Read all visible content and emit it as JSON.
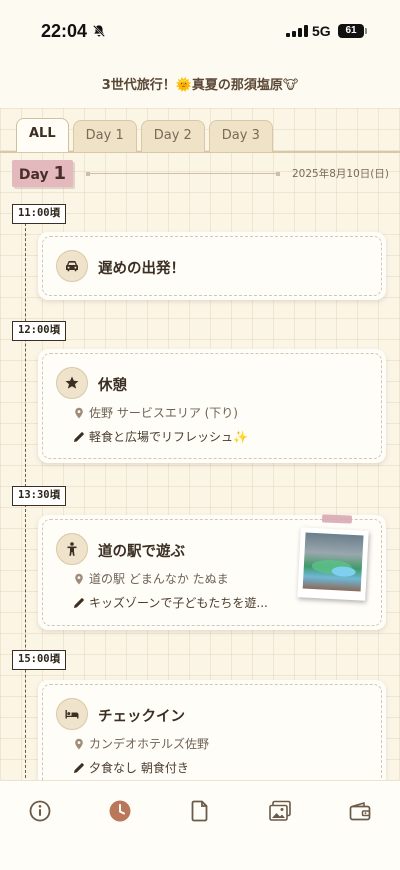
{
  "status_bar": {
    "time": "22:04",
    "network": "5G",
    "battery": "61"
  },
  "header": {
    "title": "3世代旅行！🌞真夏の那須塩原🐮"
  },
  "tabs": [
    {
      "label": "ALL",
      "active": true
    },
    {
      "label": "Day 1",
      "active": false
    },
    {
      "label": "Day 2",
      "active": false
    },
    {
      "label": "Day 3",
      "active": false
    }
  ],
  "day": {
    "prefix": "Day",
    "number": "1",
    "date": "2025年8月10日(日)"
  },
  "events": [
    {
      "time": "11:00頃",
      "icon": "car-icon",
      "title": "遅めの出発！"
    },
    {
      "time": "12:00頃",
      "icon": "star-icon",
      "title": "休憩",
      "location": "佐野 サービスエリア (下り)",
      "note": "軽食と広場でリフレッシュ✨"
    },
    {
      "time": "13:30頃",
      "icon": "child-icon",
      "title": "道の駅で遊ぶ",
      "location": "道の駅 どまんなか たぬま",
      "note": "キッズゾーンで子どもたちを遊...",
      "has_photo": true
    },
    {
      "time": "15:00頃",
      "icon": "bed-icon",
      "title": "チェックイン",
      "location": "カンデオホテルズ佐野",
      "note": "夕食なし 朝食付き"
    }
  ],
  "bottom_nav": [
    {
      "icon": "info-icon",
      "active": false
    },
    {
      "icon": "clock-icon",
      "active": true
    },
    {
      "icon": "document-icon",
      "active": false
    },
    {
      "icon": "gallery-icon",
      "active": false
    },
    {
      "icon": "wallet-icon",
      "active": false
    }
  ],
  "colors": {
    "accent": "#b9785a",
    "background": "#fbf5e6",
    "day_badge": "#e3b9bd"
  }
}
